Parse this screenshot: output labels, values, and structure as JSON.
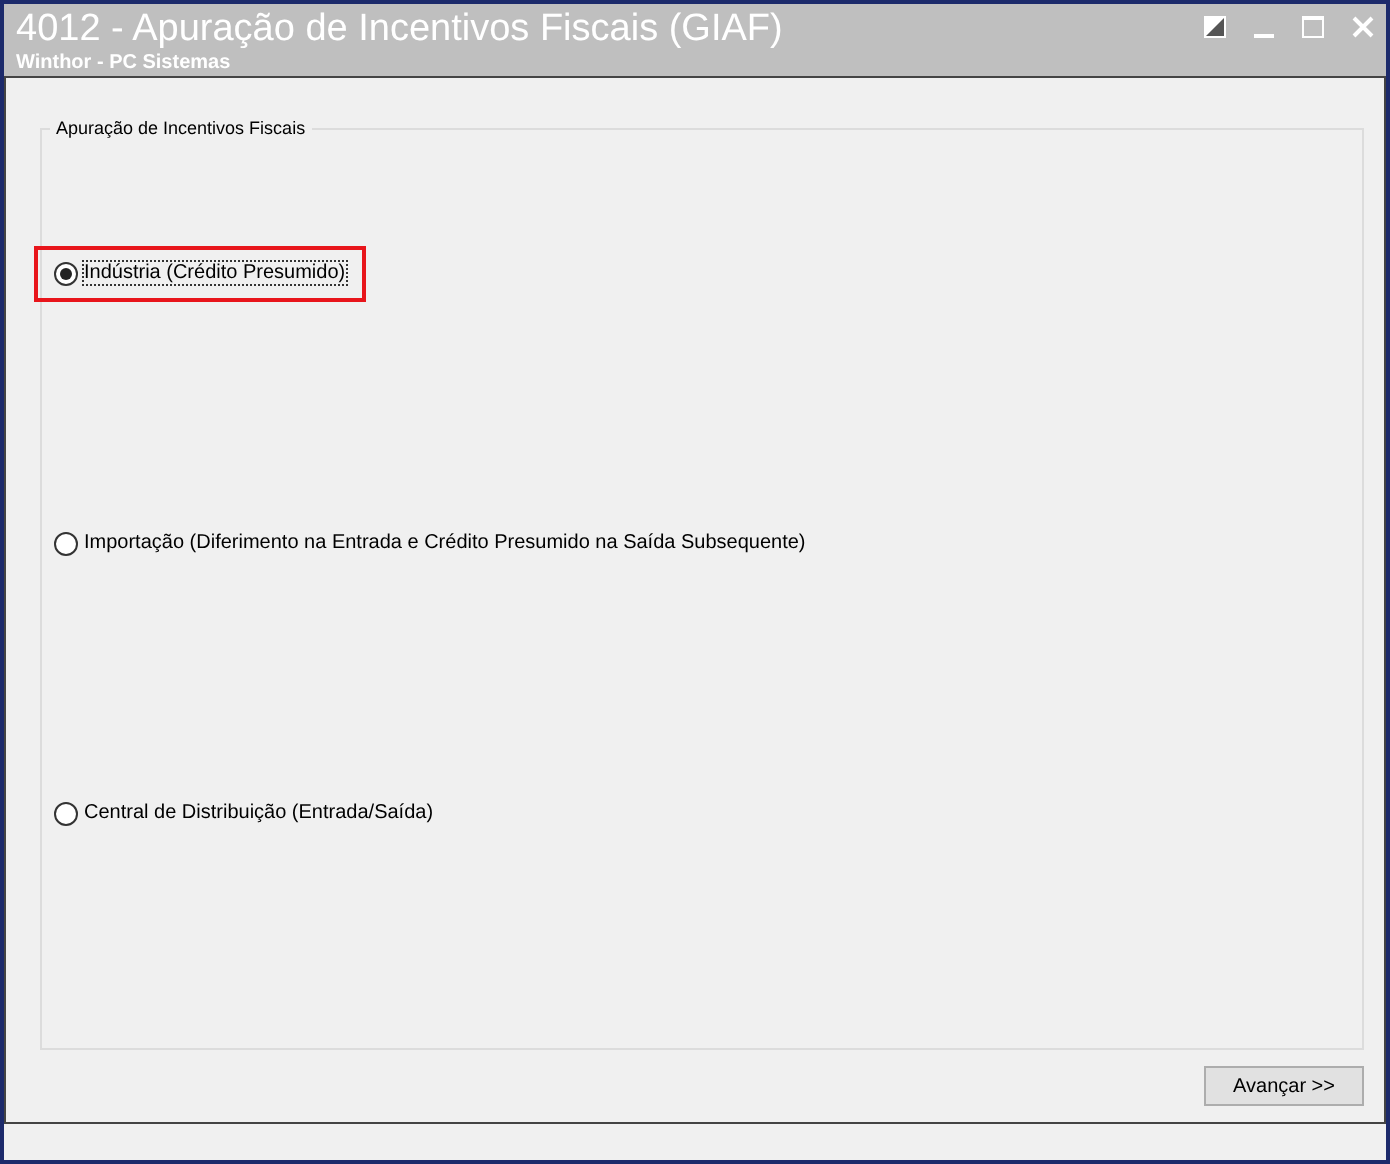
{
  "window": {
    "title": "4012 - Apuração de Incentivos Fiscais (GIAF)",
    "subtitle": "Winthor - PC Sistemas"
  },
  "group": {
    "title": "Apuração de Incentivos Fiscais",
    "options": [
      {
        "label": "Indústria (Crédito Presumido)",
        "selected": true,
        "highlighted": true
      },
      {
        "label": "Importação (Diferimento na Entrada e Crédito Presumido na Saída Subsequente)",
        "selected": false,
        "highlighted": false
      },
      {
        "label": "Central de Distribuição (Entrada/Saída)",
        "selected": false,
        "highlighted": false
      }
    ]
  },
  "buttons": [
    {
      "label": "Avançar >>"
    }
  ]
}
